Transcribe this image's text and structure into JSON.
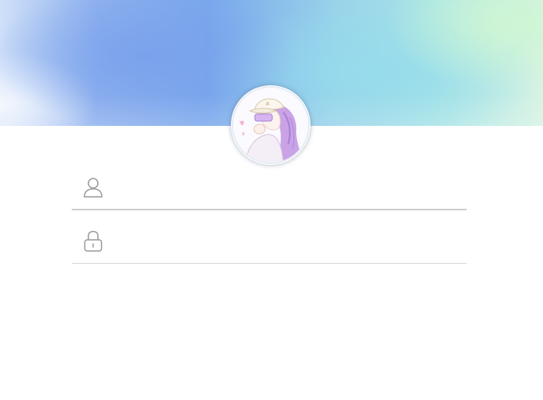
{
  "banner": {
    "colors": [
      "#cfe0f8",
      "#7aa7ec",
      "#98d3ea",
      "#d7f3e4"
    ]
  },
  "avatar": {
    "icon": "girl-with-cap-avatar"
  },
  "form": {
    "username": {
      "icon": "user-icon",
      "value": "",
      "placeholder": ""
    },
    "password": {
      "icon": "lock-icon",
      "value": "",
      "placeholder": ""
    }
  },
  "colors": {
    "field_border": "#cfcfcf",
    "icon_stroke": "#9a9a9a"
  }
}
